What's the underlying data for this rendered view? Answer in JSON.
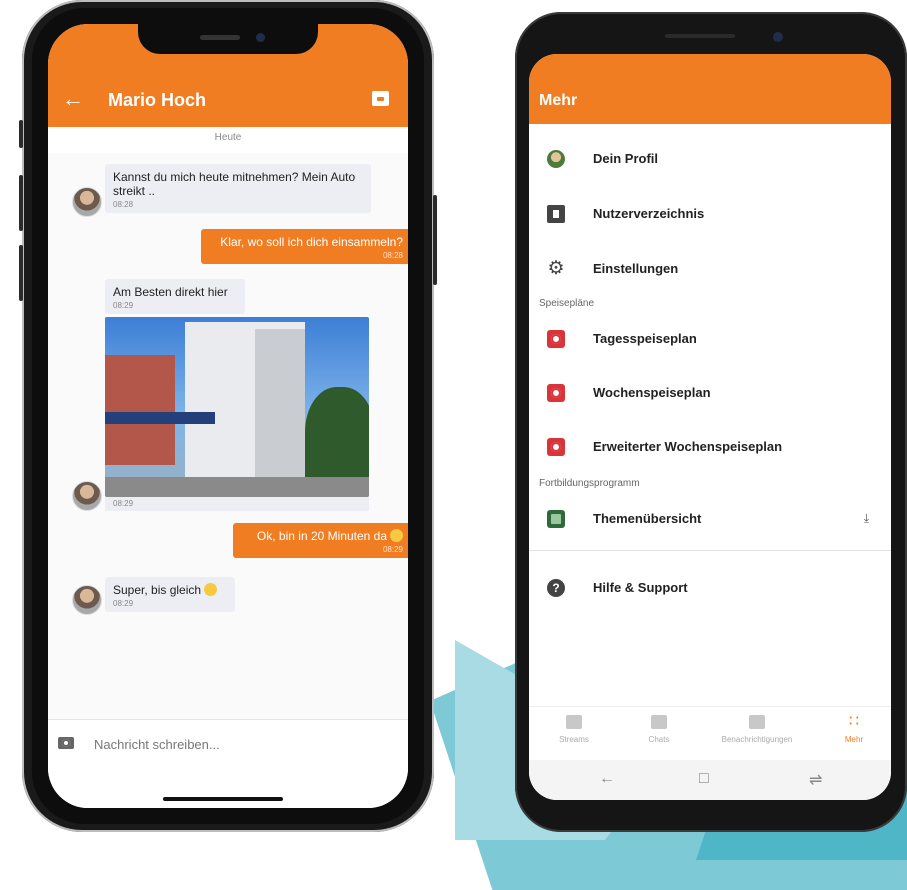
{
  "chat": {
    "contact_name": "Mario Hoch",
    "date_label": "Heute",
    "messages": [
      {
        "direction": "in",
        "text": "Kannst du mich heute mitnehmen? Mein Auto streikt ..",
        "time": "08:28"
      },
      {
        "direction": "out",
        "text": "Klar, wo soll ich dich einsammeln?",
        "time": "08:28"
      },
      {
        "direction": "in",
        "text": "Am Besten direkt hier",
        "time": "08:29"
      },
      {
        "direction": "in",
        "type": "image",
        "time": "08:29"
      },
      {
        "direction": "out",
        "text": "Ok, bin in 20 Minuten da",
        "time": "08:29"
      },
      {
        "direction": "in",
        "text": "Super, bis gleich",
        "time": "08:29"
      }
    ],
    "composer": {
      "placeholder": "Nachricht schreiben..."
    }
  },
  "more_screen": {
    "title": "Mehr",
    "items": [
      {
        "label": "Dein Profil",
        "icon": "profile-avatar-icon"
      },
      {
        "label": "Nutzerverzeichnis",
        "icon": "directory-icon"
      },
      {
        "label": "Einstellungen",
        "icon": "gear-icon"
      }
    ],
    "section_meal_plans": "Speisepläne",
    "meal_items": [
      {
        "label": "Tagesspeiseplan",
        "icon": "meal-plan-icon"
      },
      {
        "label": "Wochenspeiseplan",
        "icon": "meal-plan-icon"
      },
      {
        "label": "Erweiterter Wochenspeiseplan",
        "icon": "meal-plan-icon"
      }
    ],
    "section_training": "Fortbildungsprogramm",
    "training_items": [
      {
        "label": "Themenübersicht",
        "icon": "topic-overview-icon",
        "action_icon": "download-icon"
      }
    ],
    "help_item": {
      "label": "Hilfe & Support",
      "icon": "help-icon"
    },
    "bottom_nav": [
      {
        "label": "Streams",
        "icon": "streams-icon",
        "active": false
      },
      {
        "label": "Chats",
        "icon": "chats-icon",
        "active": false
      },
      {
        "label": "Benachrichtigungen",
        "icon": "bell-icon",
        "active": false
      },
      {
        "label": "Mehr",
        "icon": "grid-icon",
        "active": true
      }
    ],
    "system_nav": [
      "back-icon",
      "recents-icon",
      "overview-icon"
    ]
  },
  "colors": {
    "accent": "#f07d22",
    "teal": "#4fb6c8",
    "meal_icon": "#d9343a"
  }
}
